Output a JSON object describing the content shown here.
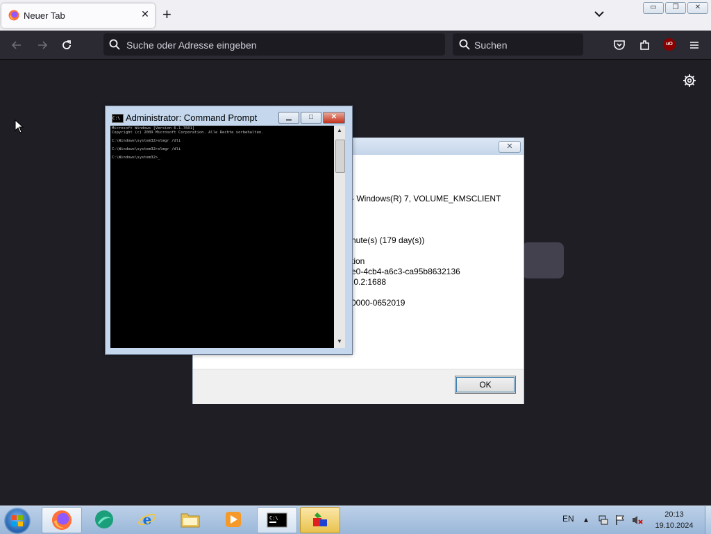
{
  "browser": {
    "tab_title": "Neuer Tab",
    "tab_close": "✕",
    "new_tab": "+",
    "urlbar_placeholder": "Suche oder Adresse eingeben",
    "searchbar_placeholder": "Suchen",
    "ublock_label": "uO",
    "window_controls": {
      "minimize": "▭",
      "restore": "❐",
      "close": "✕"
    }
  },
  "dialog": {
    "lines": [
      "- Windows(R) 7, VOLUME_KMSCLIENT",
      "nute(s) (179 day(s))",
      "tion",
      "e0-4cb4-a6c3-ca95b8632136",
      ".0.2:1688",
      "0000-0652019"
    ],
    "close": "✕",
    "ok_label": "OK"
  },
  "cmd": {
    "title": "Administrator:  Command Prompt",
    "icon_text": "C:\\",
    "buttons": {
      "minimize": "▁",
      "maximize": "□",
      "close": "✕"
    },
    "console_lines": [
      "Microsoft Windows [Version 6.1.7601]",
      "Copyright (c) 2009 Microsoft Corporation. Alle Rechte vorbehalten.",
      "",
      "C:\\Windows\\system32>slmgr /dli",
      "",
      "C:\\Windows\\system32>slmgr /dli",
      "",
      "C:\\Windows\\system32>_"
    ],
    "scroll_up": "▲",
    "scroll_down": "▼"
  },
  "taskbar": {
    "language": "EN",
    "time": "20:13",
    "date": "19.10.2024",
    "apps": [
      "firefox",
      "browser",
      "internet-explorer",
      "file-explorer",
      "media-player",
      "command-prompt",
      "color-app"
    ]
  },
  "colors": {
    "firefox_dark": "#2b2a33",
    "page_bg": "#1f1e25",
    "taskbar": "#9ab7d9"
  }
}
